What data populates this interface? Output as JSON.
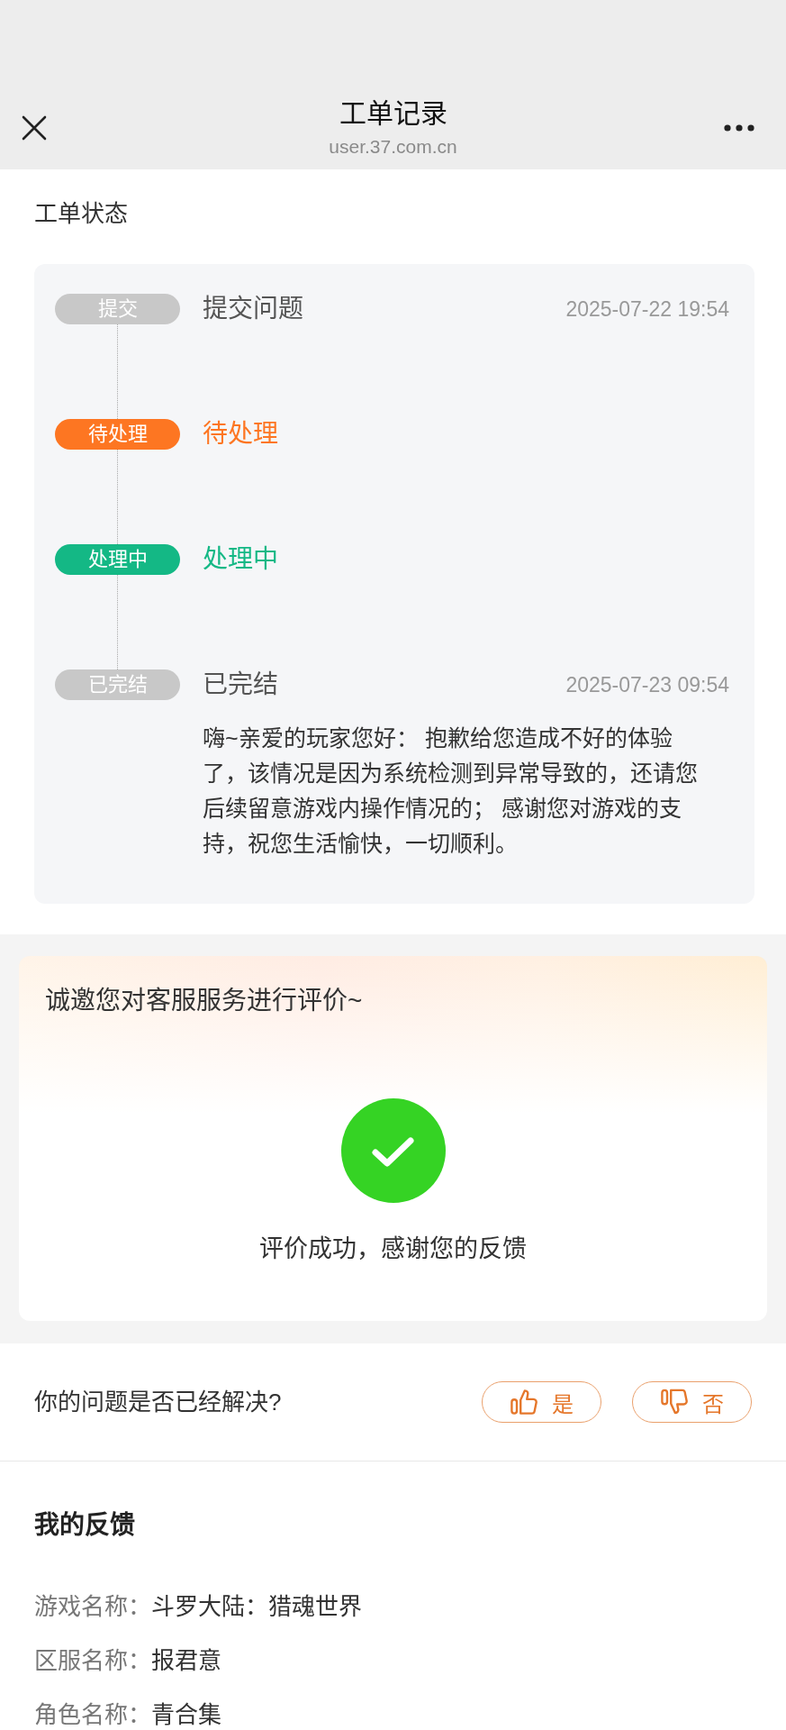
{
  "nav_bar": {
    "title": "工单记录",
    "url": "user.37.com.cn"
  },
  "ticket_status": {
    "heading": "工单状态",
    "steps": [
      {
        "badge": "提交",
        "title": "提交问题",
        "time": "2025-07-22 19:54",
        "color": "#c8c8c8",
        "highlighted": false
      },
      {
        "badge": "待处理",
        "title": "待处理",
        "color": "#fd7622",
        "highlighted": true
      },
      {
        "badge": "处理中",
        "title": "处理中",
        "color": "#14b885",
        "highlighted": true
      },
      {
        "badge": "已完结",
        "title": "已完结",
        "time": "2025-07-23 09:54",
        "color": "#c8c8c8",
        "highlighted": false,
        "message": "嗨~亲爱的玩家您好： 抱歉给您造成不好的体验了，该情况是因为系统检测到异常导致的，还请您后续留意游戏内操作情况的； 感谢您对游戏的支持，祝您生活愉快，一切顺利。"
      }
    ]
  },
  "rating": {
    "heading": "诚邀您对客服服务进行评价~",
    "result": "评价成功，感谢您的反馈"
  },
  "resolved": {
    "question": "你的问题是否已经解决?",
    "options": [
      {
        "label": "是",
        "kind": "thumbs_up",
        "selected": false
      },
      {
        "label": "否",
        "kind": "thumbs_down",
        "selected": false
      }
    ]
  },
  "feedback": {
    "heading": "我的反馈",
    "fields": [
      {
        "label": "游戏名称：",
        "value": "斗罗大陆：猎魂世界"
      },
      {
        "label": "区服名称：",
        "value": "报君意"
      },
      {
        "label": "角色名称：",
        "value": "青合集"
      }
    ]
  }
}
